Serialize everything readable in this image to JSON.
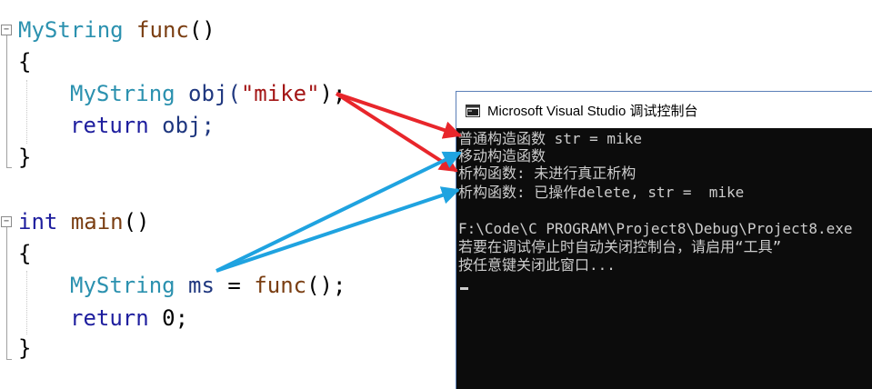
{
  "editor": {
    "func_block": {
      "ret_type": "MyString",
      "fn_name": "func",
      "params": "()",
      "open_brace": "{",
      "decl_type": "MyString",
      "decl_var": "obj(",
      "decl_str": "\"mike\"",
      "decl_end": ");",
      "return_kw": "return",
      "return_expr": "obj;",
      "close_brace": "}"
    },
    "main_block": {
      "ret_type": "int",
      "fn_name": "main",
      "params": "()",
      "open_brace": "{",
      "decl_type": "MyString",
      "decl_var": "ms",
      "decl_eq": "=",
      "decl_call": "func",
      "decl_end": "();",
      "return_kw": "return",
      "return_expr": "0;",
      "close_brace": "}"
    },
    "collapse_symbol": "−"
  },
  "console": {
    "title": "Microsoft Visual Studio 调试控制台",
    "lines": [
      "普通构造函数 str = mike",
      "移动构造函数",
      "析构函数: 未进行真正析构",
      "析构函数: 已操作delete, str =  mike",
      "",
      "F:\\Code\\C PROGRAM\\Project8\\Debug\\Project8.exe",
      "若要在调试停止时自动关闭控制台，请启用“工具”",
      "按任意键关闭此窗口..."
    ]
  },
  "annotations": {
    "red_arrow_color": "#e8262b",
    "blue_arrow_color": "#1fa3e0"
  }
}
